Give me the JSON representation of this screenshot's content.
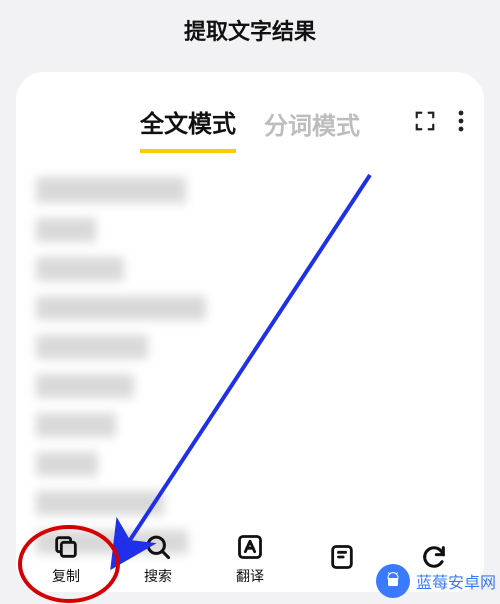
{
  "header": {
    "title": "提取文字结果"
  },
  "tabs": {
    "full": "全文模式",
    "segment": "分词模式",
    "active": "full"
  },
  "bottom": {
    "copy": "复制",
    "search": "搜索",
    "translate": "翻译",
    "note": "",
    "refresh": ""
  },
  "watermark": {
    "text": "蓝莓安卓网"
  },
  "colors": {
    "accent": "#ffcc00",
    "arrow": "#2030e8",
    "ring": "#d40000",
    "brand": "#3a7afe"
  }
}
